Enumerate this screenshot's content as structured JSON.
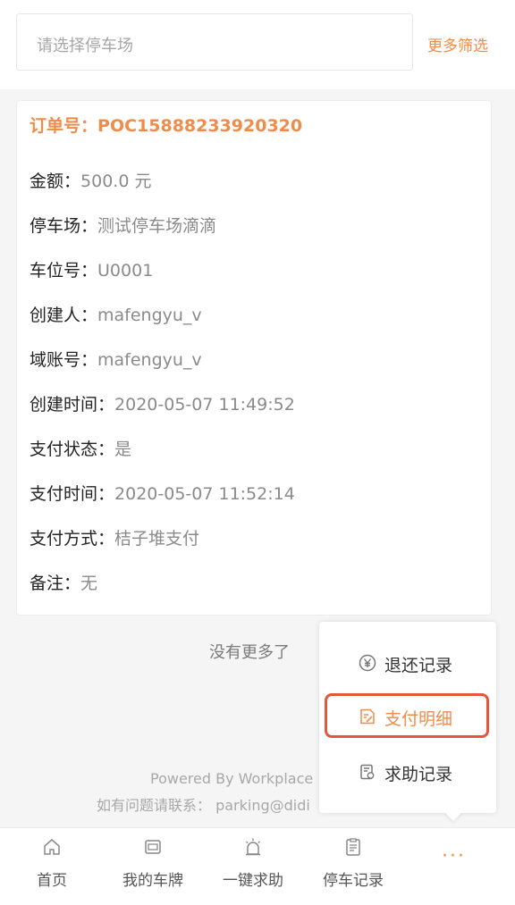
{
  "filter": {
    "placeholder": "请选择停车场",
    "more_filter_label": "更多筛选"
  },
  "order": {
    "order_no_label": "订单号：",
    "order_no": "POC15888233920320",
    "fields": [
      {
        "key": "金额：",
        "value": "500.0 元"
      },
      {
        "key": "停车场：",
        "value": "测试停车场滴滴"
      },
      {
        "key": "车位号：",
        "value": "U0001"
      },
      {
        "key": "创建人：",
        "value": "mafengyu_v"
      },
      {
        "key": "域账号：",
        "value": "mafengyu_v"
      },
      {
        "key": "创建时间：",
        "value": "2020-05-07 11:49:52"
      },
      {
        "key": "支付状态：",
        "value": "是"
      },
      {
        "key": "支付时间：",
        "value": "2020-05-07 11:52:14"
      },
      {
        "key": "支付方式：",
        "value": "桔子堆支付"
      },
      {
        "key": "备注：",
        "value": "无"
      }
    ]
  },
  "list_end_text": "没有更多了",
  "footer": {
    "line1": "Powered By Workplace",
    "line2": "如有问题请联系： parking@didi"
  },
  "popup_menu": {
    "items": [
      {
        "label": "退还记录",
        "icon": "yen-circle-icon"
      },
      {
        "label": "支付明细",
        "icon": "payment-detail-icon"
      },
      {
        "label": "求助记录",
        "icon": "help-record-icon"
      }
    ]
  },
  "tabbar": {
    "tabs": [
      {
        "label": "首页",
        "icon": "home-icon"
      },
      {
        "label": "我的车牌",
        "icon": "license-plate-icon"
      },
      {
        "label": "一键求助",
        "icon": "alarm-icon"
      },
      {
        "label": "停车记录",
        "icon": "parking-record-icon"
      }
    ],
    "more_label": "···"
  },
  "colors": {
    "accent": "#f08c4a",
    "highlight": "#e8553a"
  }
}
